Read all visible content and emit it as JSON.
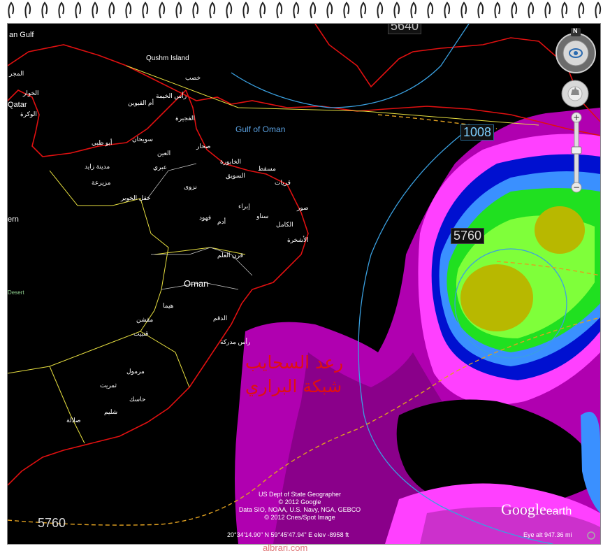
{
  "map": {
    "seas": {
      "gulf_partial": "an Gulf",
      "gulf_of_oman": "Gulf of Oman"
    },
    "islands": {
      "qushm": "Qushm Island"
    },
    "countries": {
      "oman": "Oman",
      "desert_partial": "Desert",
      "ern_partial": "ern",
      "qatar_partial": "Qatar"
    },
    "places": {
      "p1": "المجر",
      "p2": "الخوار",
      "p3": "الوكرة",
      "p4": "رأس الخيمة",
      "p5": "أم القيوين",
      "p6": "خصب",
      "p7": "الفجيرة",
      "p8": "أبو ظبي",
      "p9": "سويحان",
      "p10": "العين",
      "p11": "مدينة زايد",
      "p12": "مزيرعة",
      "p13": "حقل الخوير",
      "p14": "مسقط",
      "p15": "صحار",
      "p16": "الخابورة",
      "p17": "السويق",
      "p18": "قريات",
      "p19": "صور",
      "p20": "فهود",
      "p21": "الكامل",
      "p22": "الأشخرة",
      "p23": "قرن العلم",
      "p24": "هيما",
      "p25": "الدقم",
      "p26": "رأس مدركة",
      "p27": "مقشن",
      "p28": "قتبيت",
      "p29": "مرمول",
      "p30": "ثمريت",
      "p31": "حاسك",
      "p32": "شليم",
      "p33": "صلالة",
      "p34": "عبري",
      "p35": "نزوى",
      "p36": "إبراء",
      "p37": "سناو",
      "p38": "أدم"
    },
    "isolines": {
      "top_partial": "5640",
      "pressure": "1008",
      "thickness": "5760",
      "bottom_left": "5760"
    },
    "overlay_text": {
      "line1": "رعد السحايب",
      "line2": "شبكة البراري"
    },
    "credits": {
      "line1": "US Dept of State Geographer",
      "line2": "© 2012 Google",
      "line3": "Data SIO, NOAA, U.S. Navy, NGA, GEBCO",
      "line4": "© 2012 Cnes/Spot Image"
    },
    "coordinates": "20°34'14.90\" N   59°45'47.94\" E  elev  -8958 ft",
    "eye_alt": "Eye alt   947.36 mi",
    "logo_google": "Google",
    "logo_earth": "earth",
    "compass_letter": "N"
  },
  "footer": {
    "watermark": "albrari.com"
  },
  "colors": {
    "coast": "#e01010",
    "border": "#e8e040",
    "isobar": "#3aa0e0",
    "isotherm": "#e0a020"
  }
}
